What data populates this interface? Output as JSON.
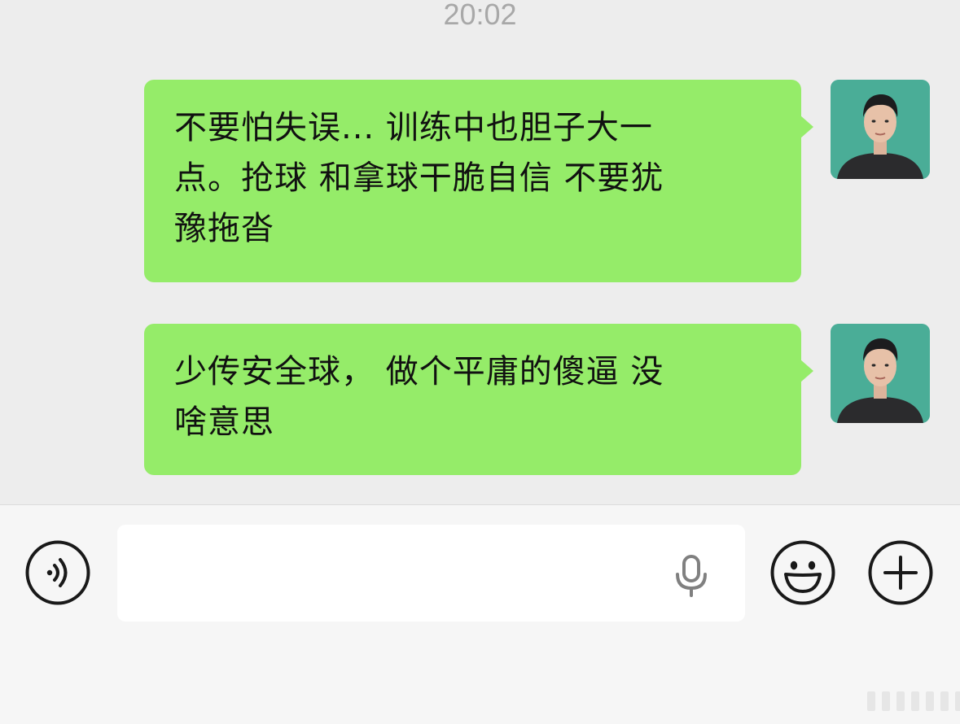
{
  "chat": {
    "timestamp": "20:02",
    "messages": [
      {
        "sender": "self",
        "lines": [
          "不要怕失误... 训练中也胆子大一",
          "点。抢球 和拿球干脆自信 不要犹",
          "豫拖沓"
        ]
      },
      {
        "sender": "self",
        "lines": [
          "少传安全球， 做个平庸的傻逼 没",
          "啥意思"
        ]
      }
    ]
  },
  "colors": {
    "background": "#ededed",
    "bubble_self": "#95ec69",
    "input_bar": "#f6f6f6",
    "timestamp": "#a8a8a8"
  },
  "input_bar": {
    "text_value": "",
    "icons": [
      "voice-icon",
      "mic-icon",
      "emoji-icon",
      "plus-icon"
    ]
  }
}
